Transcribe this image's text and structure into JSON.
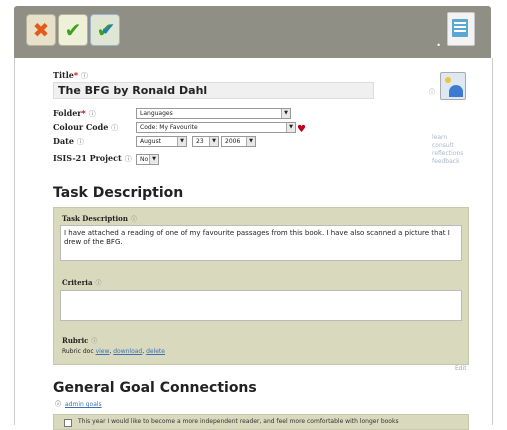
{
  "toolbar": {
    "cancel_icon": "cancel-x-icon",
    "save_icon": "check-icon",
    "save_all_icon": "double-check-icon",
    "document_icon": "document-icon",
    "help_mark": "•"
  },
  "form": {
    "title_label": "Title",
    "title_value": "The BFG by Ronald Dahl",
    "folder_label": "Folder",
    "folder_value": "Languages",
    "colour_label": "Colour Code",
    "colour_value": "Code: My Favourite",
    "date_label": "Date",
    "date_month": "August",
    "date_day": "23",
    "date_year": "2006",
    "isis_label": "ISIS-21 Project",
    "isis_value": "No",
    "required_mark": "*",
    "help_mark": "ⓘ"
  },
  "side_links": [
    "learn",
    "consult",
    "reflections",
    "feedback"
  ],
  "task": {
    "section_title": "Task Description",
    "desc_label": "Task Description",
    "desc_value": "I have attached a reading of one of my favourite passages from this book. I have also scanned a picture that I drew of the BFG.",
    "criteria_label": "Criteria",
    "criteria_value": "",
    "rubric_label": "Rubric",
    "rubric_prefix": "Rubric doc",
    "rubric_view": "view",
    "rubric_download": "download",
    "rubric_delete": "delete",
    "edit_link": "Edit"
  },
  "goals": {
    "section_title": "General Goal Connections",
    "admin_link": "admin goals",
    "first_goal_text": "This year I would like to become a more independent reader, and feel more comfortable with longer books"
  },
  "colors": {
    "toolbar_bg": "#8f8f86",
    "panel_bg": "#d9d9bd",
    "heart": "#c0001a",
    "link": "#3b6fb8"
  }
}
